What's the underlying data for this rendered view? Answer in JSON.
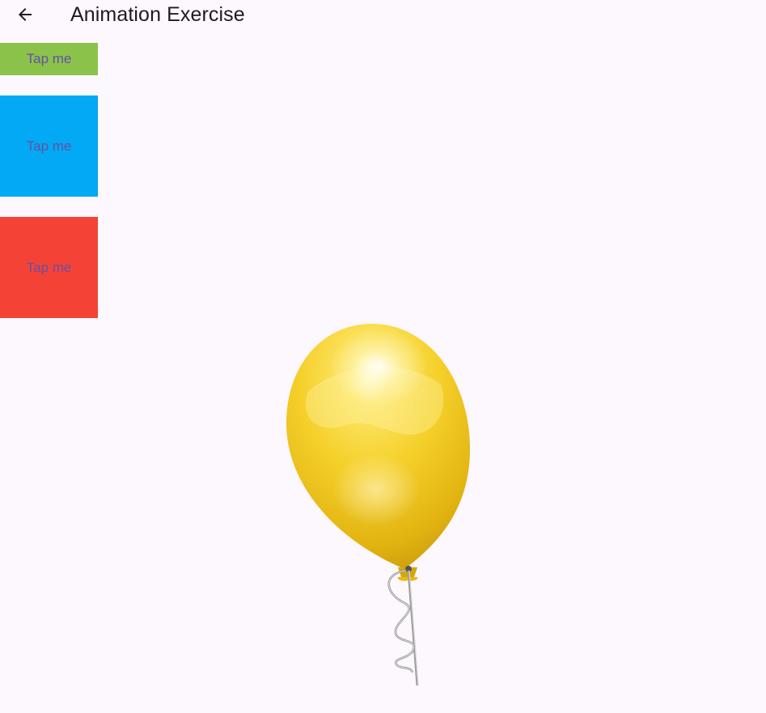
{
  "app_bar": {
    "title": "Animation Exercise",
    "back_icon": "arrow-left-icon"
  },
  "tap_boxes": [
    {
      "label": "Tap me",
      "color": "#8bc34a"
    },
    {
      "label": "Tap me",
      "color": "#03a9f4"
    },
    {
      "label": "Tap me",
      "color": "#f44336"
    }
  ],
  "balloon": {
    "icon": "balloon-icon",
    "color": "#f2c418"
  },
  "colors": {
    "background": "#fdf7fe",
    "label_text": "#6750a4",
    "title_text": "#1d1b20"
  }
}
